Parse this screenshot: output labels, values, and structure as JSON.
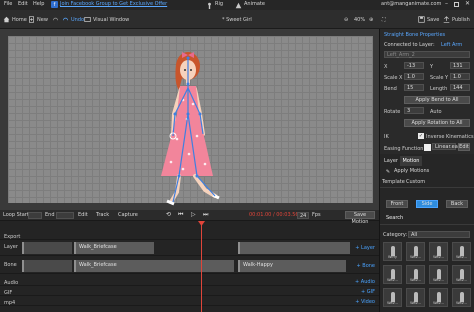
{
  "menu": {
    "file": "File",
    "edit": "Edit",
    "help": "Help",
    "promo": "Join Facebook Group to Get Exclusive Offer",
    "rig": "Rig",
    "animate": "Animate",
    "email": "ant@manganimate.com"
  },
  "toolbar": {
    "home": "Home",
    "new": "New",
    "undo": "Undo",
    "visual_window": "Visual Window",
    "doc": "* Sweet Girl",
    "zoom": "40%",
    "save": "Save",
    "publish": "Publish"
  },
  "inspector": {
    "title": "Straight Bone Properties",
    "connected_label": "Connected to Layer:",
    "connected_value": "Left Arm",
    "bone_name": "Left_Arm_2",
    "x_label": "X",
    "x_val": "-13",
    "y_label": "Y",
    "y_val": "131",
    "sx_label": "Scale X",
    "sx_val": "1.0",
    "sy_label": "Scale Y",
    "sy_val": "1.0",
    "bend_label": "Bend",
    "bend_val": "15",
    "len_label": "Length",
    "len_val": "144",
    "apply_bend": "Apply Bend to All",
    "rotate_label": "Rotate",
    "rotate_val": "3",
    "auto": "Auto",
    "apply_rot": "Apply Rotation to All",
    "ik_label": "IK",
    "ik_check": "Inverse Kinematics",
    "easing_label": "Easing Function",
    "easing_val": "Linear.ea",
    "edit": "Edit"
  },
  "motion": {
    "tab_layer": "Layer",
    "tab_motion": "Motion",
    "apply": "Apply Motions",
    "template": "Template",
    "custom": "Custom",
    "search": "Search",
    "btn_a": "Front",
    "btn_b": "Side",
    "btn_c": "Back",
    "category_label": "Category:",
    "category_val": "All",
    "thumbs": [
      "Wiffy",
      "Wav...",
      "Wav...",
      "Wav...",
      "Wav...",
      "Wav...",
      "Wav...",
      "Wav...",
      "Wav...",
      "Wav...",
      "Wav...",
      "Wav..."
    ]
  },
  "timeline": {
    "loop_start": "Loop Start",
    "end": "End",
    "edit": "Edit",
    "track": "Track",
    "capture": "Capture",
    "time": "00:01.00 / 00:03.56",
    "fps_val": "24",
    "fps_label": "Fps",
    "save_motion": "Save Motion",
    "tracks": [
      {
        "name": "Export",
        "add": ""
      },
      {
        "name": "Layer",
        "add": "+ Layer",
        "clips": [
          "Walk_Briefcase"
        ]
      },
      {
        "name": "Bone",
        "add": "+ Bone",
        "clips": [
          "Walk_Briefcase",
          "Walk-Happy"
        ]
      },
      {
        "name": "Audio",
        "add": "+ Audio"
      },
      {
        "name": "GIF",
        "add": "+ GIF"
      },
      {
        "name": "mp4",
        "add": "+ Video"
      }
    ]
  },
  "colors": {
    "accent": "#2f8dde",
    "promo": "#5aa8ff",
    "playhead": "#e0453a",
    "character_dress": "#f2859b",
    "hair": "#c8552b",
    "bone": "#3f7fe0"
  }
}
